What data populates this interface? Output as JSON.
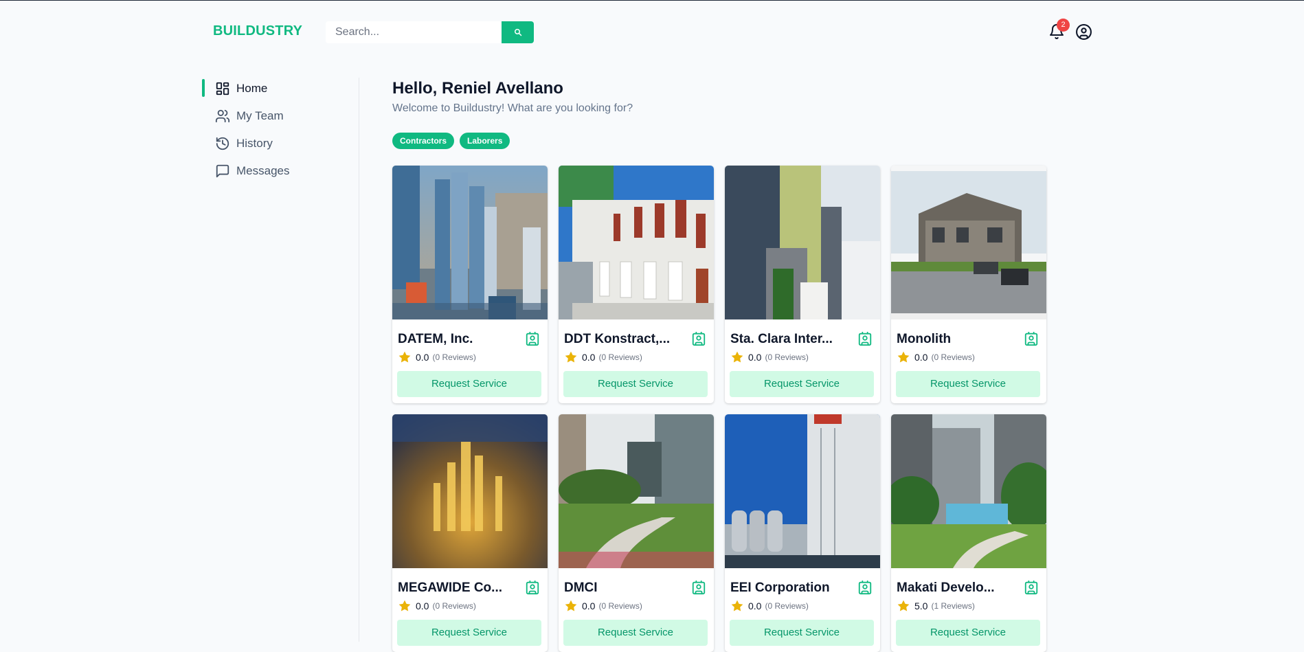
{
  "header": {
    "logo": "BUILDUSTRY",
    "search_placeholder": "Search...",
    "notification_count": "2"
  },
  "sidebar": {
    "items": [
      {
        "label": "Home",
        "icon": "dashboard-icon",
        "active": true
      },
      {
        "label": "My Team",
        "icon": "users-icon",
        "active": false
      },
      {
        "label": "History",
        "icon": "history-icon",
        "active": false
      },
      {
        "label": "Messages",
        "icon": "message-icon",
        "active": false
      }
    ]
  },
  "main": {
    "greeting": "Hello, Reniel Avellano",
    "subtitle": "Welcome to Buildustry! What are you looking for?",
    "chips": [
      "Contractors",
      "Laborers"
    ],
    "request_label": "Request Service",
    "cards": [
      {
        "name": "DATEM, Inc.",
        "rating": "0.0",
        "reviews": "(0 Reviews)"
      },
      {
        "name": "DDT Konstract,...",
        "rating": "0.0",
        "reviews": "(0 Reviews)"
      },
      {
        "name": "Sta. Clara Inter...",
        "rating": "0.0",
        "reviews": "(0 Reviews)"
      },
      {
        "name": "Monolith",
        "rating": "0.0",
        "reviews": "(0 Reviews)"
      },
      {
        "name": "MEGAWIDE Co...",
        "rating": "0.0",
        "reviews": "(0 Reviews)"
      },
      {
        "name": "DMCI",
        "rating": "0.0",
        "reviews": "(0 Reviews)"
      },
      {
        "name": "EEI Corporation",
        "rating": "0.0",
        "reviews": "(0 Reviews)"
      },
      {
        "name": "Makati Develo...",
        "rating": "5.0",
        "reviews": "(1 Reviews)"
      }
    ]
  },
  "colors": {
    "brand": "#10b981",
    "button_bg": "#d1fae5",
    "star": "#eab308",
    "badge": "#ef4444"
  }
}
